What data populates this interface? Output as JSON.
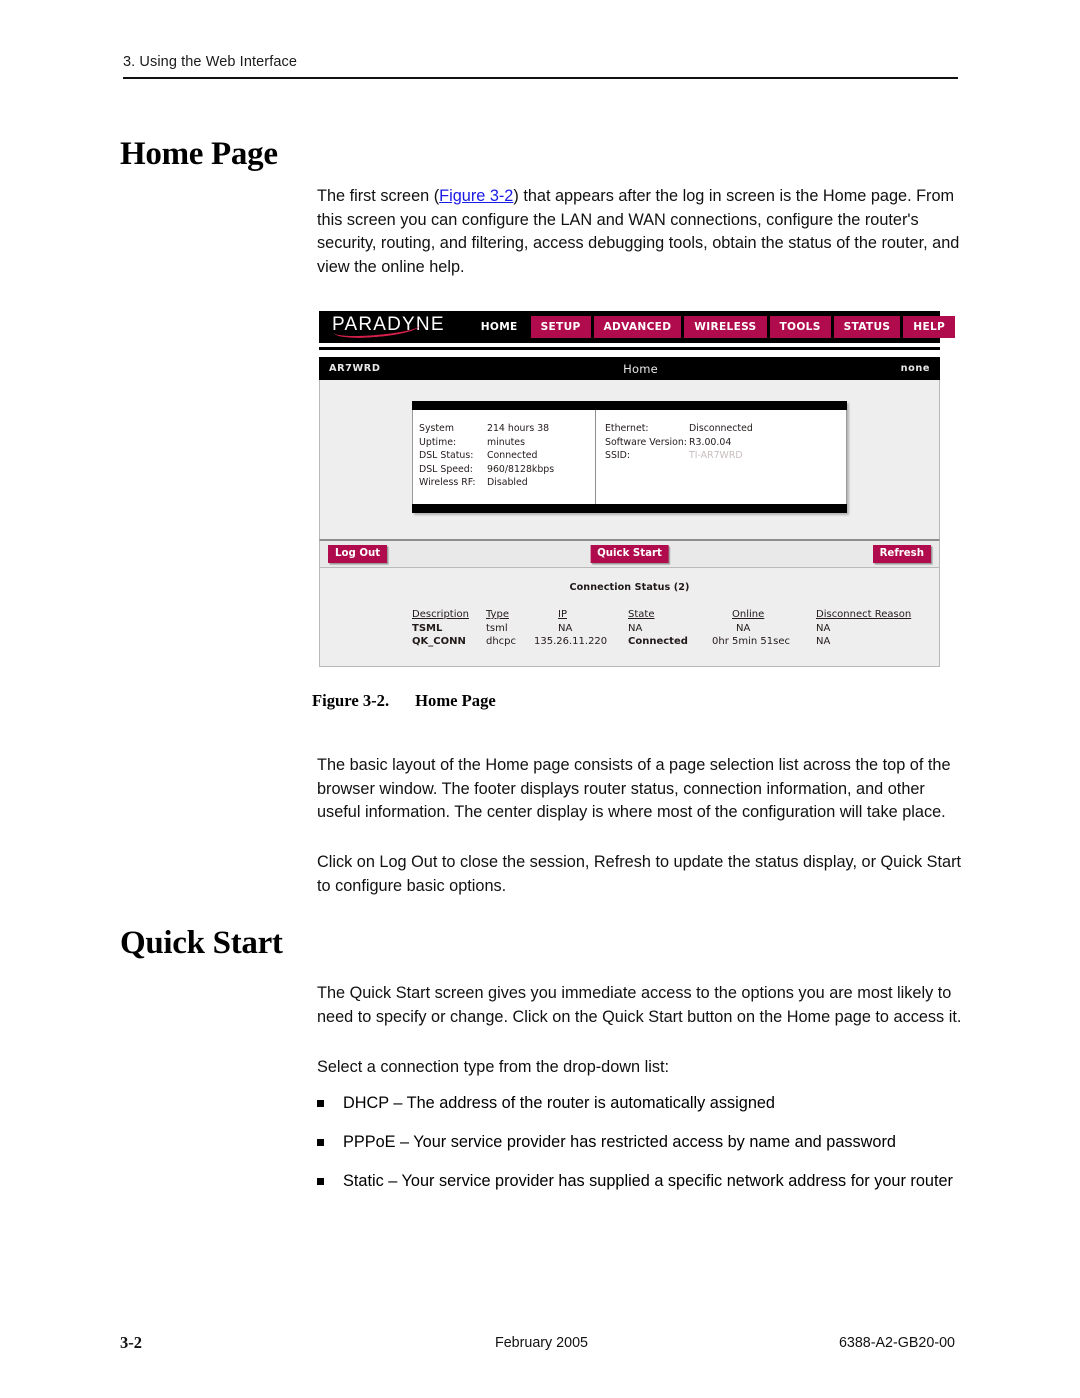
{
  "header": {
    "running_head": "3. Using the Web Interface"
  },
  "sections": {
    "home_page": {
      "title": "Home Page",
      "paragraph_1_pre": "The first screen (",
      "paragraph_1_link": "Figure 3-2",
      "paragraph_1_post": ") that appears after the log in screen is the Home page. From this screen you can configure the LAN and WAN connections, configure the router's security, routing, and filtering, access debugging tools, obtain the status of the router, and view the online help.",
      "paragraph_2": "The basic layout of the Home page consists of a page selection list across the top of the browser window. The footer displays router status, connection information, and other useful information. The center display is where most of the configuration will take place.",
      "paragraph_3": "Click on Log Out to close the session, Refresh to update the status display, or Quick Start to configure basic options."
    },
    "quick_start": {
      "title": "Quick Start",
      "paragraph_1": "The Quick Start screen gives you immediate access to the options you are most likely to need to specify or change. Click on the Quick Start button on the Home page to access it.",
      "paragraph_2": "Select a connection type from the drop-down list:",
      "bullets": [
        "DHCP – The address of the router is automatically assigned",
        "PPPoE – Your service provider has restricted access by name and password",
        "Static – Your service provider has supplied a specific network address for your router"
      ]
    }
  },
  "figure": {
    "caption_label": "Figure 3-2.",
    "caption_text": "Home Page",
    "screenshot": {
      "brand": "PARADYNE",
      "nav": [
        {
          "label": "HOME",
          "style": "active"
        },
        {
          "label": "SETUP",
          "style": "tabbed"
        },
        {
          "label": "ADVANCED",
          "style": "tabbed"
        },
        {
          "label": "WIRELESS",
          "style": "tabbed"
        },
        {
          "label": "TOOLS",
          "style": "tabbed"
        },
        {
          "label": "STATUS",
          "style": "tabbed"
        },
        {
          "label": "HELP",
          "style": "tabbed"
        }
      ],
      "subbar": {
        "device": "AR7WRD",
        "page": "Home",
        "user": "none"
      },
      "status_left": [
        {
          "label": "System Uptime:",
          "value": "214 hours 38 minutes"
        },
        {
          "label": "DSL Status:",
          "value": "Connected"
        },
        {
          "label": "DSL Speed:",
          "value": "960/8128kbps"
        },
        {
          "label": "Wireless RF:",
          "value": "Disabled"
        }
      ],
      "status_right": [
        {
          "label": "Ethernet:",
          "value": "Disconnected"
        },
        {
          "label": "Software Version:",
          "value": "R3.00.04"
        },
        {
          "label": "SSID:",
          "value": "TI-AR7WRD"
        }
      ],
      "buttons": {
        "log_out": "Log Out",
        "quick_start": "Quick Start",
        "refresh": "Refresh"
      },
      "connection_status": {
        "title": "Connection Status (2)",
        "columns": [
          "Description",
          "Type",
          "IP",
          "State",
          "Online",
          "Disconnect Reason"
        ],
        "rows": [
          {
            "description": "TSML",
            "type": "tsml",
            "ip": "NA",
            "state": "NA",
            "online": "NA",
            "reason": "NA"
          },
          {
            "description": "QK_CONN",
            "type": "dhcpc",
            "ip": "135.26.11.220",
            "state": "Connected",
            "online": "0hr 5min 51sec",
            "reason": "NA"
          }
        ]
      },
      "colors": {
        "accent": "#b00b4c",
        "bar": "#000000",
        "panel": "#eeeeee"
      }
    }
  },
  "footer": {
    "page_number": "3-2",
    "date": "February 2005",
    "doc_number": "6388-A2-GB20-00"
  }
}
